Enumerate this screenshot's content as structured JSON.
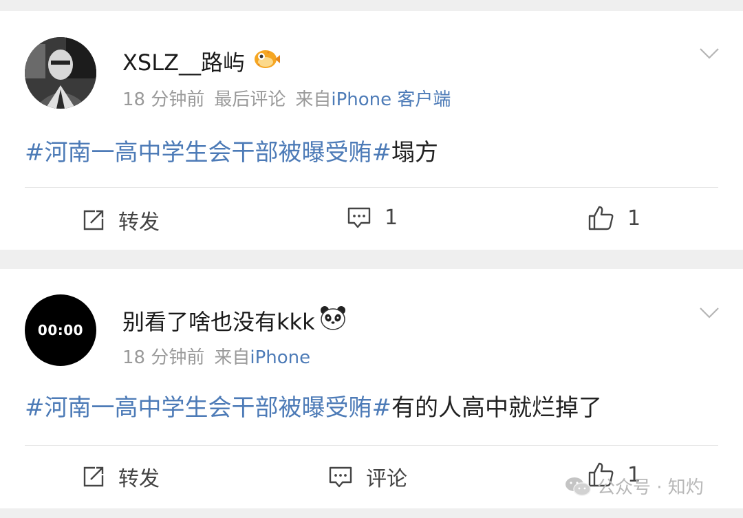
{
  "posts": [
    {
      "username": "XSLZ__路屿",
      "badge_icon": "pufferfish-emoji-icon",
      "time": "18 分钟前",
      "extra": "最后评论",
      "source_prefix": "来自",
      "source": "iPhone 客户端",
      "topic": "#河南一高中学生会干部被曝受贿#",
      "text": "塌方",
      "actions": {
        "repost": "转发",
        "comment": "1",
        "like": "1"
      }
    },
    {
      "avatar_text": "00:00",
      "username": "别看了啥也没有kkk",
      "badge_icon": "panda-emoji-icon",
      "time": "18 分钟前",
      "source_prefix": "来自",
      "source": "iPhone",
      "topic": "#河南一高中学生会干部被曝受贿#",
      "text": "有的人高中就烂掉了",
      "actions": {
        "repost": "转发",
        "comment": "评论",
        "like": "1"
      }
    }
  ],
  "watermark": "公众号 · 知灼",
  "colors": {
    "link": "#4d7bb7",
    "meta": "#9a9a9a",
    "background": "#efefef"
  }
}
